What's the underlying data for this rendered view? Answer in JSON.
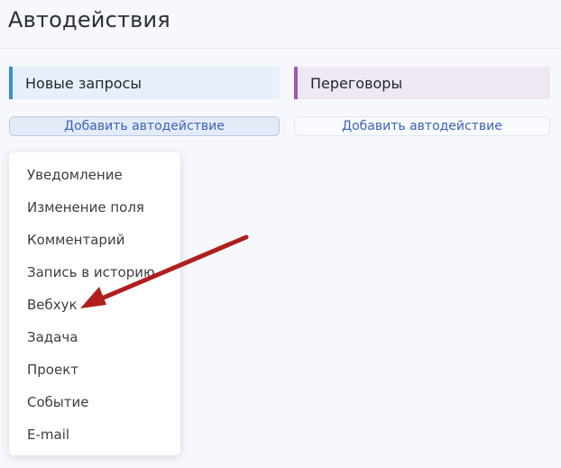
{
  "page": {
    "title": "Автодействия"
  },
  "stages": [
    {
      "name": "Новые запросы",
      "accent_color": "#3b8ed0",
      "background": "#e7f0fa",
      "add_label": "Добавить автодействие"
    },
    {
      "name": "Переговоры",
      "accent_color": "#9b59b6",
      "background": "#efe8f4",
      "add_label": "Добавить автодействие"
    }
  ],
  "menu": {
    "items": [
      "Уведомление",
      "Изменение поля",
      "Комментарий",
      "Запись в историю",
      "Вебхук",
      "Задача",
      "Проект",
      "Событие",
      "E-mail"
    ]
  },
  "annotation": {
    "arrow_color": "#b01e1e",
    "points_to": "Вебхук"
  }
}
